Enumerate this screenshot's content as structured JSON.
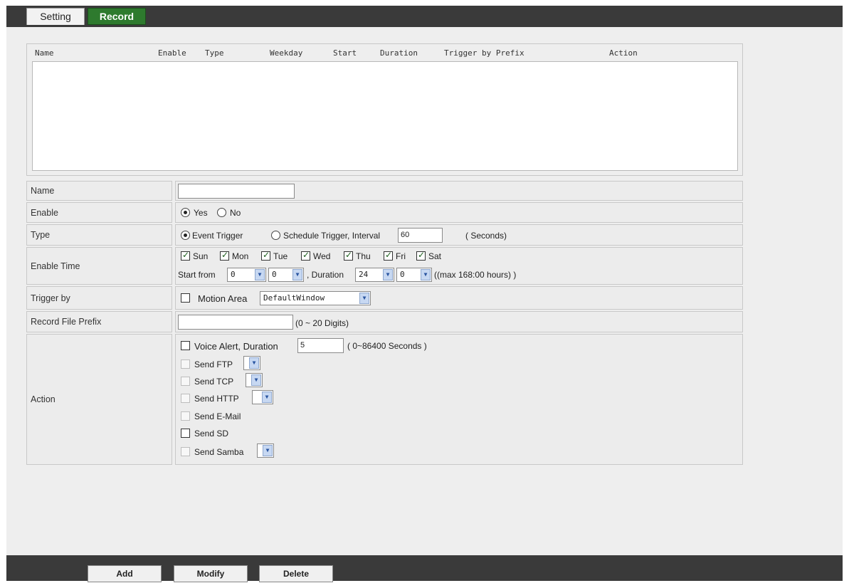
{
  "tabs": {
    "setting": "Setting",
    "record": "Record"
  },
  "list": {
    "columns": [
      "Name",
      "Enable",
      "Type",
      "Weekday",
      "Start",
      "Duration",
      "Trigger by Prefix",
      "Action"
    ]
  },
  "form": {
    "name": {
      "label": "Name",
      "value": ""
    },
    "enable": {
      "label": "Enable",
      "yes": "Yes",
      "no": "No",
      "selected": "Yes"
    },
    "type": {
      "label": "Type",
      "event": "Event Trigger",
      "schedule": "Schedule Trigger, Interval",
      "interval": "60",
      "unit": "( Seconds)",
      "selected": "Event Trigger"
    },
    "enable_time": {
      "label": "Enable Time",
      "days": [
        "Sun",
        "Mon",
        "Tue",
        "Wed",
        "Thu",
        "Fri",
        "Sat"
      ],
      "start_from": "Start from",
      "start_hour": "0",
      "start_min": "0",
      "duration_label": ", Duration",
      "duration_hour": "24",
      "duration_min": "0",
      "max_note": "((max 168:00 hours) )"
    },
    "trigger_by": {
      "label": "Trigger by",
      "motion_area": "Motion Area",
      "window": "DefaultWindow"
    },
    "prefix": {
      "label": "Record File Prefix",
      "value": "",
      "hint": "(0 ~ 20 Digits)"
    },
    "action": {
      "label": "Action",
      "voice_alert": "Voice Alert, Duration",
      "voice_duration": "5",
      "voice_hint": "( 0~86400 Seconds )",
      "send_ftp": "Send FTP",
      "send_tcp": "Send TCP",
      "send_http": "Send HTTP",
      "send_email": "Send E-Mail",
      "send_sd": "Send SD",
      "send_samba": "Send Samba"
    }
  },
  "buttons": {
    "add": "Add",
    "modify": "Modify",
    "delete": "Delete"
  }
}
